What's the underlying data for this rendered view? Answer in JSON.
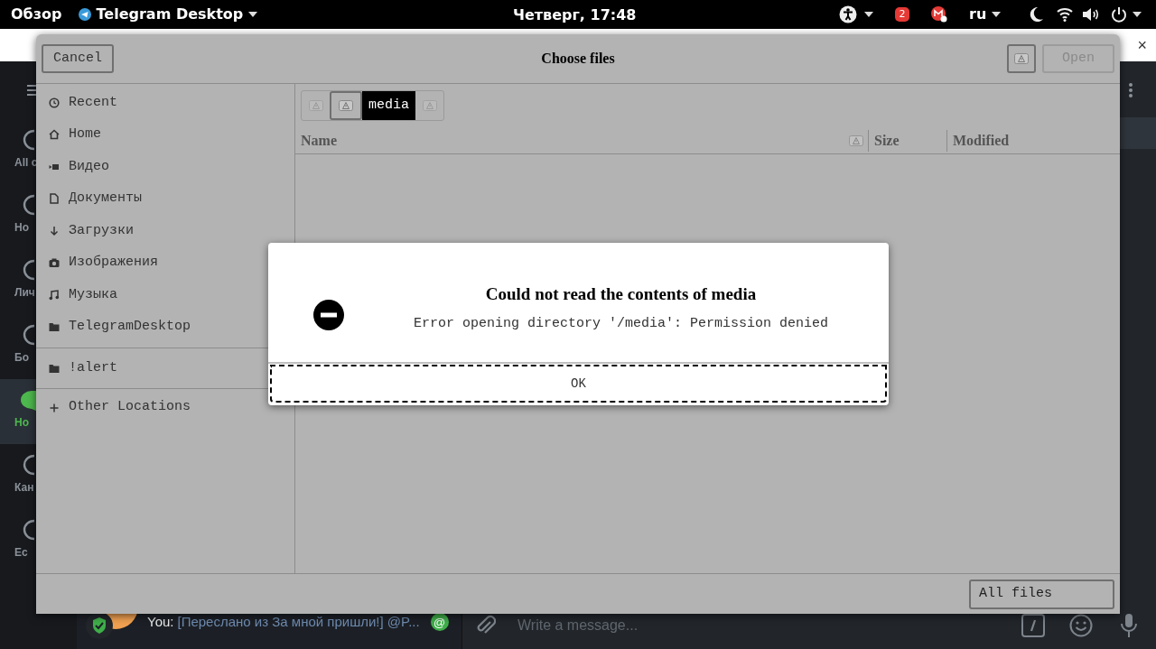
{
  "top_bar": {
    "activities": "Обзор",
    "app_menu": "Telegram Desktop",
    "clock": "Четверг, 17:48",
    "notification_count": "2",
    "language": "ru"
  },
  "background_app": {
    "close_button": "×",
    "folders": [
      {
        "label": "All c",
        "selected": false
      },
      {
        "label": "Но",
        "selected": false
      },
      {
        "label": "Лич",
        "selected": false
      },
      {
        "label": "Бо",
        "selected": false
      },
      {
        "label": "Но",
        "selected": true
      },
      {
        "label": "Кан",
        "selected": false
      },
      {
        "label": "Ес",
        "selected": false
      }
    ],
    "chat_preview": {
      "sender": "You:",
      "text": "[Переслано из За мной пришли!] @P...",
      "mention_badge": "@"
    },
    "composer": {
      "placeholder": "Write a message..."
    }
  },
  "file_dialog": {
    "title": "Choose files",
    "cancel": "Cancel",
    "open": {
      "label": "Open",
      "disabled": true
    },
    "places": [
      [
        {
          "label": "Recent"
        },
        {
          "label": "Home"
        },
        {
          "label": "Видео"
        },
        {
          "label": "Документы"
        },
        {
          "label": "Загрузки"
        },
        {
          "label": "Изображения"
        },
        {
          "label": "Музыка"
        },
        {
          "label": "TelegramDesktop"
        }
      ],
      [
        {
          "label": "!alert"
        }
      ],
      [
        {
          "label": "Other Locations"
        }
      ]
    ],
    "path_bar": [
      {
        "kind": "icon",
        "selected": false,
        "disabled": true
      },
      {
        "kind": "icon",
        "selected": false,
        "disabled": false
      },
      {
        "kind": "text",
        "label": "media",
        "selected": true
      },
      {
        "kind": "icon",
        "selected": false,
        "disabled": true
      }
    ],
    "columns": [
      "Name",
      "Size",
      "Modified"
    ],
    "filter": "All files"
  },
  "error_dialog": {
    "title": "Could not read the contents of media",
    "message": "Error opening directory '/media': Permission denied",
    "button": "OK"
  }
}
